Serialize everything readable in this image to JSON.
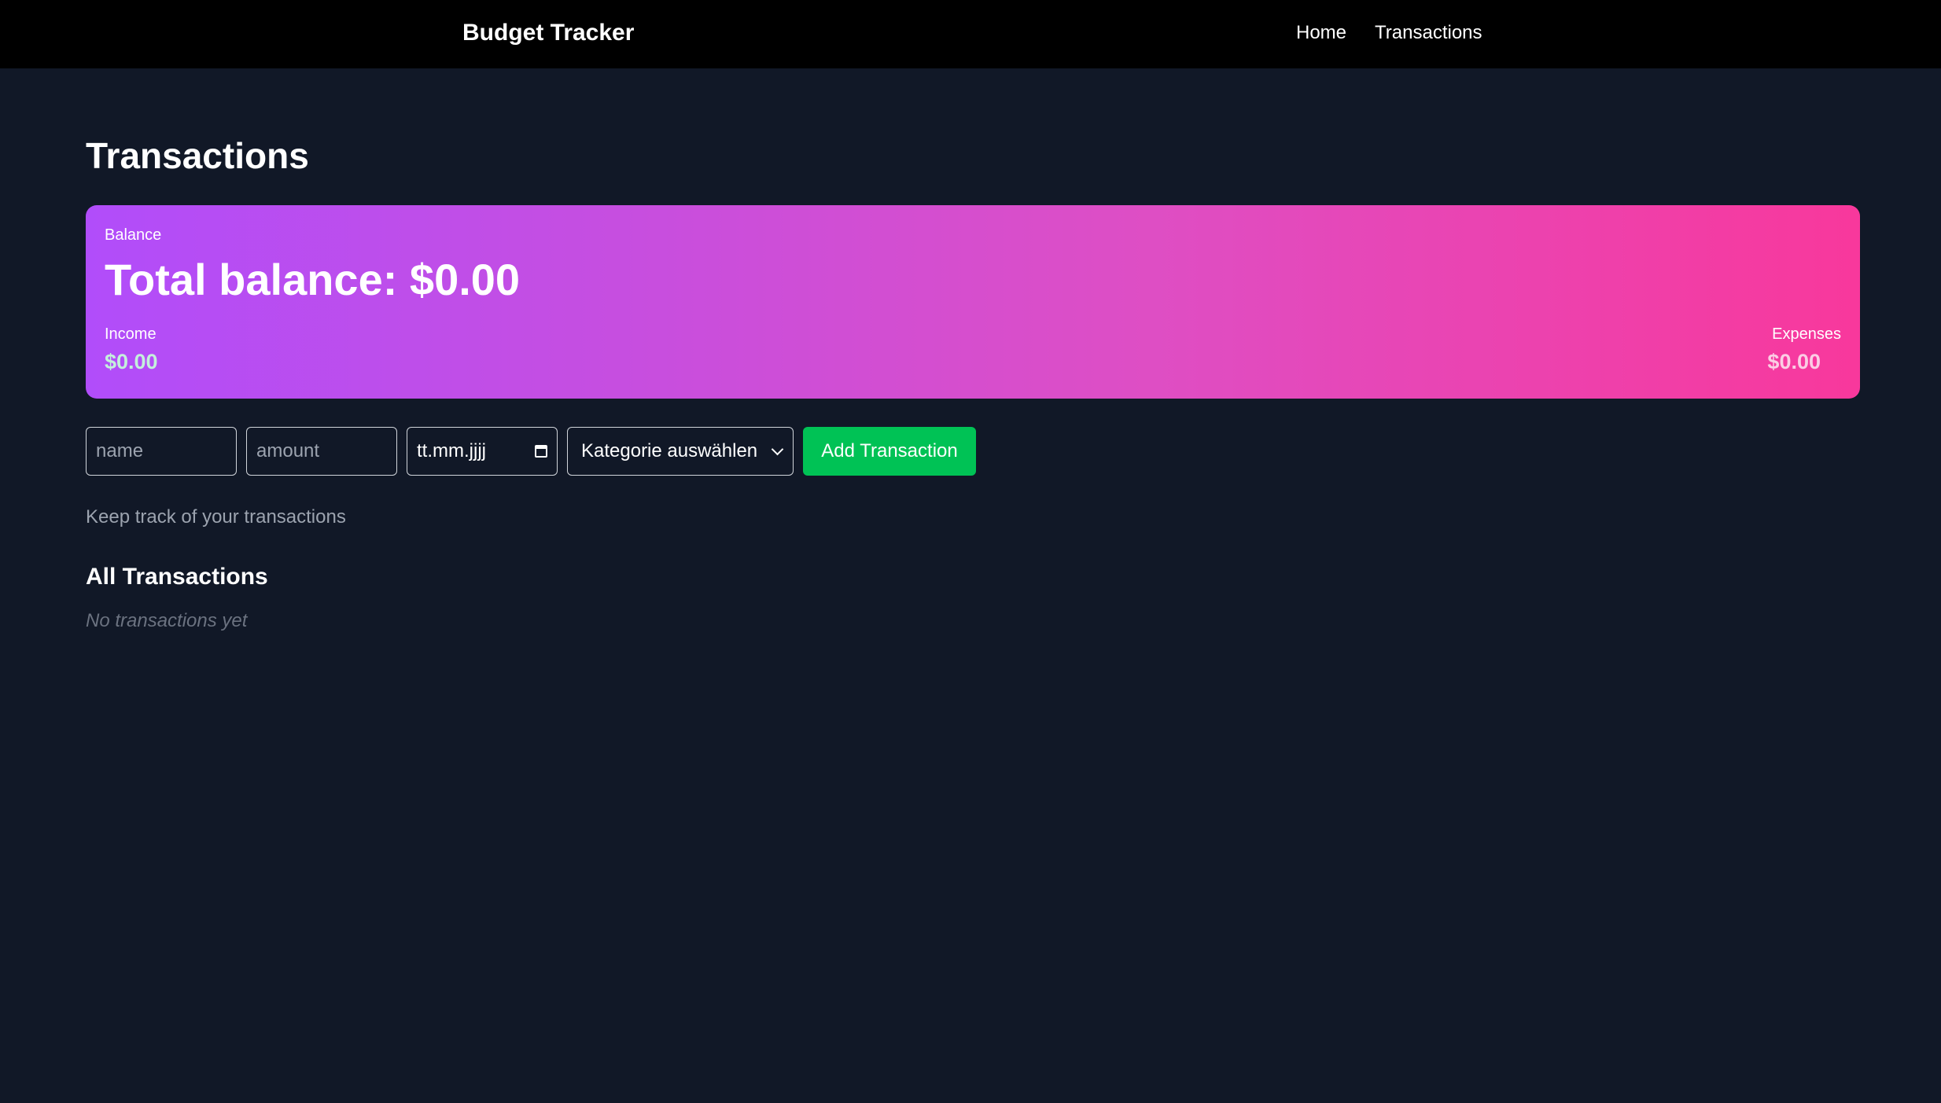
{
  "app": {
    "brand": "Budget Tracker"
  },
  "nav": {
    "items": [
      {
        "label": "Home"
      },
      {
        "label": "Transactions"
      }
    ]
  },
  "page": {
    "title": "Transactions",
    "subtitle": "Keep track of your transactions"
  },
  "balance": {
    "label": "Balance",
    "total": "Total balance: $0.00",
    "income_label": "Income",
    "income_value": "$0.00",
    "expenses_label": "Expenses",
    "expenses_value": "$0.00",
    "gradient_start": "#b14dfa",
    "gradient_end": "#f8389c"
  },
  "form": {
    "name_placeholder": "name",
    "amount_placeholder": "amount",
    "date_placeholder": "tt.mm.jjjj",
    "category_selected": "Kategorie auswählen",
    "add_button": "Add Transaction",
    "add_button_color": "#00c255",
    "date_icon": "calendar-icon",
    "select_icon": "chevron-down-icon"
  },
  "transactions": {
    "section_title": "All Transactions",
    "empty_message": "No transactions yet"
  },
  "colors": {
    "background": "#111827",
    "topbar": "#000000"
  }
}
